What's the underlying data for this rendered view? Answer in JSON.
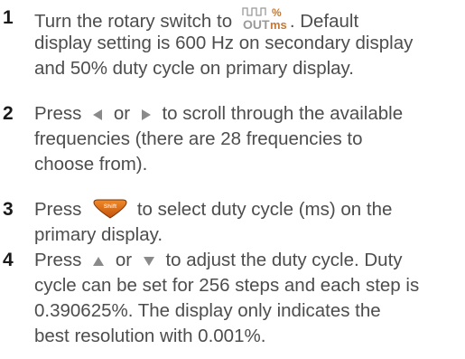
{
  "colors": {
    "text": "#4d4d4d",
    "number": "#1a1a1a",
    "arrow": "#8a8a8a",
    "symbol": "#c07a3a",
    "shift_button": "#e06a12"
  },
  "icons": {
    "rotary_symbol": "square-wave-out-percent-ms-symbol",
    "left": "left-arrow-key-icon",
    "right": "right-arrow-key-icon",
    "up": "up-arrow-key-icon",
    "down": "down-arrow-key-icon",
    "shift": "shift-button-icon"
  },
  "steps": [
    {
      "number": "1",
      "l1a": "Turn the rotary switch to",
      "l1b": ". Default",
      "l2": "display setting is 600 Hz on secondary display",
      "l3": "and 50% duty cycle on primary display."
    },
    {
      "number": "2",
      "l1a": "Press",
      "l1b": "or",
      "l1c": "to scroll through the available",
      "l2": "frequencies (there are 28 frequencies to",
      "l3": "choose from)."
    },
    {
      "number": "3",
      "l1a": "Press",
      "l1b": "to select duty cycle (ms) on the",
      "l2": "primary display."
    },
    {
      "number": "4",
      "l1a": "Press",
      "l1b": "or",
      "l1c": "to adjust the duty cycle. Duty",
      "l2": "cycle can be set for 256 steps and each step is",
      "l3": "0.390625%. The display only indicates the",
      "l4": "best resolution with 0.001%."
    }
  ],
  "symbol_text": {
    "out": "OUT",
    "percent": "%",
    "ms": "ms"
  },
  "shift_label": "Shift"
}
